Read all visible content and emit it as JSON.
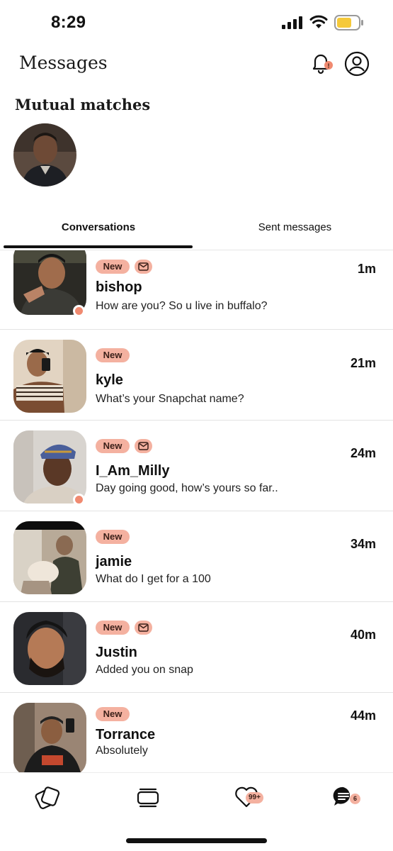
{
  "status_bar": {
    "time": "8:29"
  },
  "header": {
    "title": "Messages",
    "bell_badge": "!",
    "icons": {
      "bell": "bell-icon",
      "profile": "profile-icon"
    }
  },
  "mutual_matches": {
    "title": "Mutual matches"
  },
  "tabs": [
    {
      "label": "Conversations",
      "active": true
    },
    {
      "label": "Sent messages",
      "active": false
    }
  ],
  "conversations": [
    {
      "name": "bishop",
      "preview": "How are you? So u live in buffalo?",
      "time": "1m",
      "badge": "New",
      "mail_badge": true,
      "online": true
    },
    {
      "name": "kyle",
      "preview": "What’s your Snapchat name?",
      "time": "21m",
      "badge": "New",
      "mail_badge": false,
      "online": false
    },
    {
      "name": "I_Am_Milly",
      "preview": "Day going good, how’s yours so far..",
      "time": "24m",
      "badge": "New",
      "mail_badge": true,
      "online": true
    },
    {
      "name": "jamie",
      "preview": "What do I get for a 100",
      "time": "34m",
      "badge": "New",
      "mail_badge": false,
      "online": false
    },
    {
      "name": "Justin",
      "preview": "Added you on snap",
      "time": "40m",
      "badge": "New",
      "mail_badge": true,
      "online": false
    },
    {
      "name": "Torrance",
      "preview": "Absolutely",
      "time": "44m",
      "badge": "New",
      "mail_badge": false,
      "online": false
    }
  ],
  "bottom_nav": {
    "items": [
      {
        "icon": "discover-icon"
      },
      {
        "icon": "standouts-icon"
      },
      {
        "icon": "likes-heart-icon",
        "badge": "99+"
      },
      {
        "icon": "messages-icon",
        "badge": "6",
        "active": true
      }
    ]
  },
  "colors": {
    "accent": "#f4b1a0",
    "online": "#f08a70",
    "text": "#111111",
    "divider": "#e3e3e3"
  }
}
